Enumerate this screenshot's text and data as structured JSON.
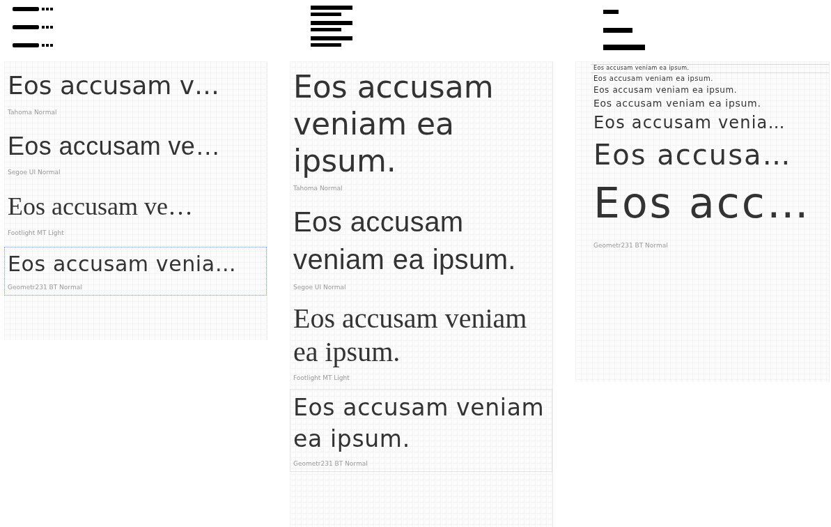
{
  "panels": [
    {
      "kind": "single",
      "items": [
        {
          "sample": "Eos accusam v…",
          "font": "Tahoma Normal",
          "selected": false
        },
        {
          "sample": "Eos accusam ve…",
          "font": "Segoe UI Normal",
          "selected": false
        },
        {
          "sample": "Eos accusam ve…",
          "font": "Footlight MT Light",
          "selected": false
        },
        {
          "sample": "Eos accusam venia…",
          "font": "Geometr231 BT Normal",
          "selected": true
        }
      ]
    },
    {
      "kind": "multi",
      "items": [
        {
          "sample": "Eos accusam veniam ea ipsum.",
          "font": "Tahoma Normal",
          "hovered": false
        },
        {
          "sample": "Eos accusam veniam ea ipsum.",
          "font": "Segoe UI Normal",
          "hovered": false
        },
        {
          "sample": "Eos accusam veniam ea ipsum.",
          "font": "Footlight MT Light",
          "hovered": false
        },
        {
          "sample": "Eos accusam veniam ea ipsum.",
          "font": "Geometr231 BT Normal",
          "hovered": true
        }
      ]
    },
    {
      "kind": "waterfall",
      "font": "Geometr231 BT Normal",
      "lines": [
        {
          "sample": "Eos accusam veniam ea ipsum.",
          "hovered": true
        },
        {
          "sample": "Eos accusam veniam ea ipsum.",
          "hovered": false
        },
        {
          "sample": "Eos accusam veniam ea ipsum.",
          "hovered": false
        },
        {
          "sample": "Eos accusam veniam ea ipsum.",
          "hovered": false
        },
        {
          "sample": "Eos accusam venia…",
          "hovered": false
        },
        {
          "sample": "Eos accusa…",
          "hovered": false
        },
        {
          "sample": "Eos acc…",
          "hovered": false
        }
      ]
    }
  ]
}
